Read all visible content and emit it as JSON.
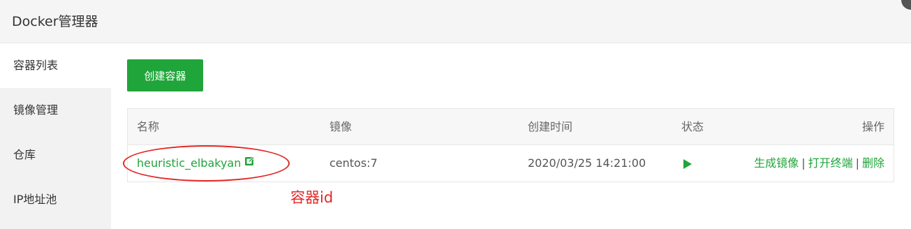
{
  "window": {
    "title": "Docker管理器"
  },
  "sidebar": {
    "items": [
      {
        "label": "容器列表",
        "active": true
      },
      {
        "label": "镜像管理",
        "active": false
      },
      {
        "label": "仓库",
        "active": false
      },
      {
        "label": "IP地址池",
        "active": false
      }
    ]
  },
  "main": {
    "create_button": "创建容器",
    "table": {
      "headers": {
        "name": "名称",
        "image": "镜像",
        "created": "创建时间",
        "status": "状态",
        "actions": "操作"
      },
      "rows": [
        {
          "name": "heuristic_elbakyan",
          "image": "centos:7",
          "created": "2020/03/25 14:21:00",
          "status_icon": "play-icon",
          "actions": {
            "make_image": "生成镜像",
            "separator": "|",
            "open_terminal": "打开终端",
            "delete": "删除"
          }
        }
      ]
    }
  },
  "annotation": {
    "text": "容器id",
    "color": "#e32727"
  },
  "colors": {
    "accent": "#20a53a",
    "annotation_red": "#e32727"
  }
}
